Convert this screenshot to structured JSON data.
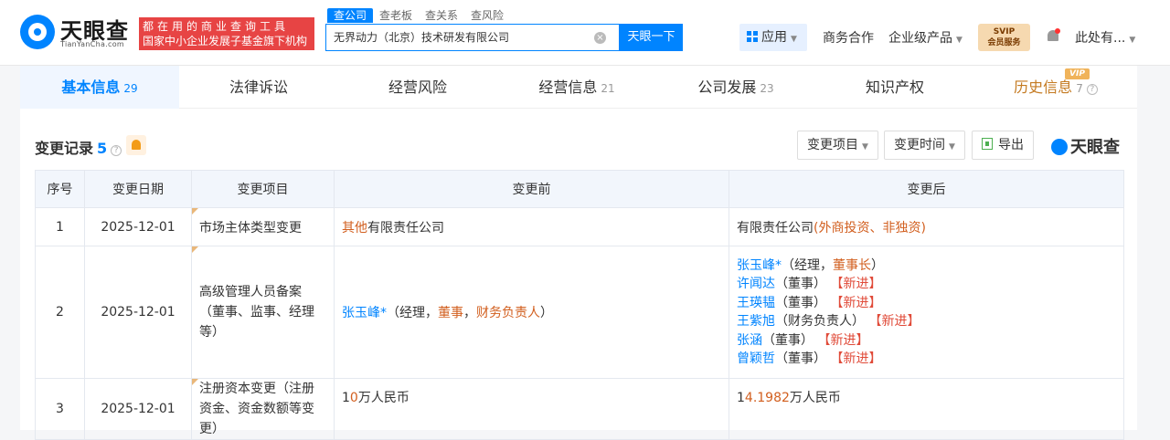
{
  "header": {
    "logo_text": "天眼查",
    "logo_sub": "TianYanCha.com",
    "slogan_line1": "都在用的商业查询工具",
    "slogan_line2": "国家中小企业发展子基金旗下机构",
    "search_tabs": [
      "查公司",
      "查老板",
      "查关系",
      "查风险"
    ],
    "search_value": "无界动力（北京）技术研发有限公司",
    "search_button": "天眼一下",
    "apps": "应用",
    "business": "商务合作",
    "enterprise": "企业级产品",
    "svip_line1": "SVIP",
    "svip_line2": "会员服务",
    "user": "此处有..."
  },
  "tabs": [
    {
      "label": "基本信息",
      "count": "29"
    },
    {
      "label": "法律诉讼",
      "count": ""
    },
    {
      "label": "经营风险",
      "count": ""
    },
    {
      "label": "经营信息",
      "count": "21"
    },
    {
      "label": "公司发展",
      "count": "23"
    },
    {
      "label": "知识产权",
      "count": ""
    },
    {
      "label": "历史信息",
      "count": "7"
    }
  ],
  "vip_badge": "VIP",
  "section": {
    "title": "变更记录",
    "count": "5",
    "filter_item": "变更项目",
    "filter_time": "变更时间",
    "export": "导出",
    "watermark": "天眼查"
  },
  "table": {
    "headers": [
      "序号",
      "变更日期",
      "变更项目",
      "变更前",
      "变更后"
    ],
    "rows": [
      {
        "no": "1",
        "date": "2025-12-01",
        "item": "市场主体类型变更",
        "before_hl": "其他",
        "before_rest": "有限责任公司",
        "after_main": "有限责任公司",
        "after_hl": "(外商投资、非独资)"
      },
      {
        "no": "2",
        "date": "2025-12-01",
        "item": "高级管理人员备案（董事、监事、经理等）",
        "before_name": "张玉峰*",
        "before_p1": "（经理，",
        "before_r1": "董事",
        "before_p2": "，",
        "before_r2": "财务负责人",
        "before_p3": "）",
        "after_people": [
          {
            "name": "张玉峰*",
            "role": "（经理，",
            "hl": "董事长",
            "tail": "）",
            "tag": ""
          },
          {
            "name": "许闻达",
            "role": "（董事）",
            "hl": "",
            "tail": "",
            "tag": "【新进】"
          },
          {
            "name": "王瑛韫",
            "role": "（董事）",
            "hl": "",
            "tail": "",
            "tag": "【新进】"
          },
          {
            "name": "王紫旭",
            "role": "（财务负责人）",
            "hl": "",
            "tail": "",
            "tag": "【新进】"
          },
          {
            "name": "张涵",
            "role": "（董事）",
            "hl": "",
            "tail": "",
            "tag": "【新进】"
          },
          {
            "name": "曾颖哲",
            "role": "（董事）",
            "hl": "",
            "tail": "",
            "tag": "【新进】"
          }
        ]
      },
      {
        "no": "3",
        "date": "2025-12-01",
        "item": "注册资本变更（注册资金、资金数额等变更）",
        "before_a": "1",
        "before_hl": "0",
        "before_rest": "万人民币",
        "after_a": "1",
        "after_hl": "4.1982",
        "after_rest": "万人民币"
      }
    ]
  }
}
